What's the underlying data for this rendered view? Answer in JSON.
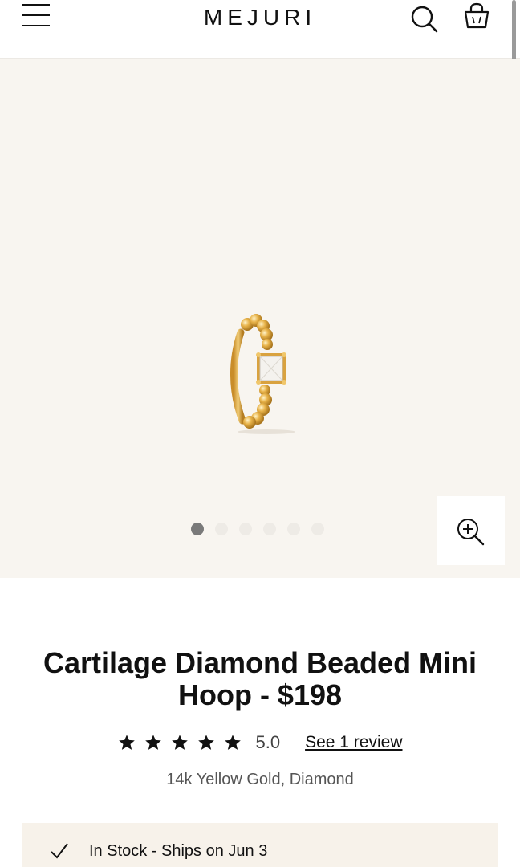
{
  "header": {
    "logo": "MEJURI",
    "menu_icon": "hamburger-menu-icon",
    "search_icon": "search-icon",
    "bag_icon": "shopping-bag-icon"
  },
  "gallery": {
    "image_count": 6,
    "active_index": 0,
    "zoom_icon": "zoom-in-icon",
    "background": "#f8f5f0"
  },
  "product": {
    "title": "Cartilage Diamond Beaded Mini Hoop - $198",
    "rating_stars": 5,
    "rating_value": "5.0",
    "review_link": "See 1 review",
    "material": "14k Yellow Gold, Diamond"
  },
  "availability": {
    "icon": "check-icon",
    "text": "In Stock - Ships on Jun 3"
  }
}
